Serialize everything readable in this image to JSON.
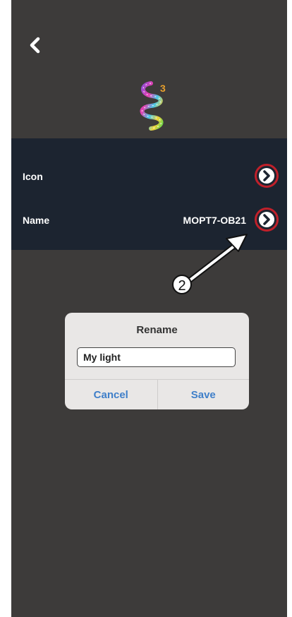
{
  "header": {
    "back_icon": "chevron-left-icon",
    "device_icon": "led-strip-icon",
    "badge_count": "3"
  },
  "settings": {
    "rows": [
      {
        "label": "Icon",
        "value": "",
        "icon": "chevron-right-icon"
      },
      {
        "label": "Name",
        "value": "MOPT7-OB21",
        "icon": "chevron-right-icon"
      }
    ]
  },
  "annotation": {
    "step_number": "2",
    "highlight_color": "#c0202a"
  },
  "dialog": {
    "title": "Rename",
    "input_value": "My light",
    "cancel_label": "Cancel",
    "save_label": "Save"
  },
  "colors": {
    "background": "#3d3b3a",
    "settings_bg": "#1c2430",
    "accent_blue": "#3f7fc9",
    "badge": "#e9a02c"
  }
}
